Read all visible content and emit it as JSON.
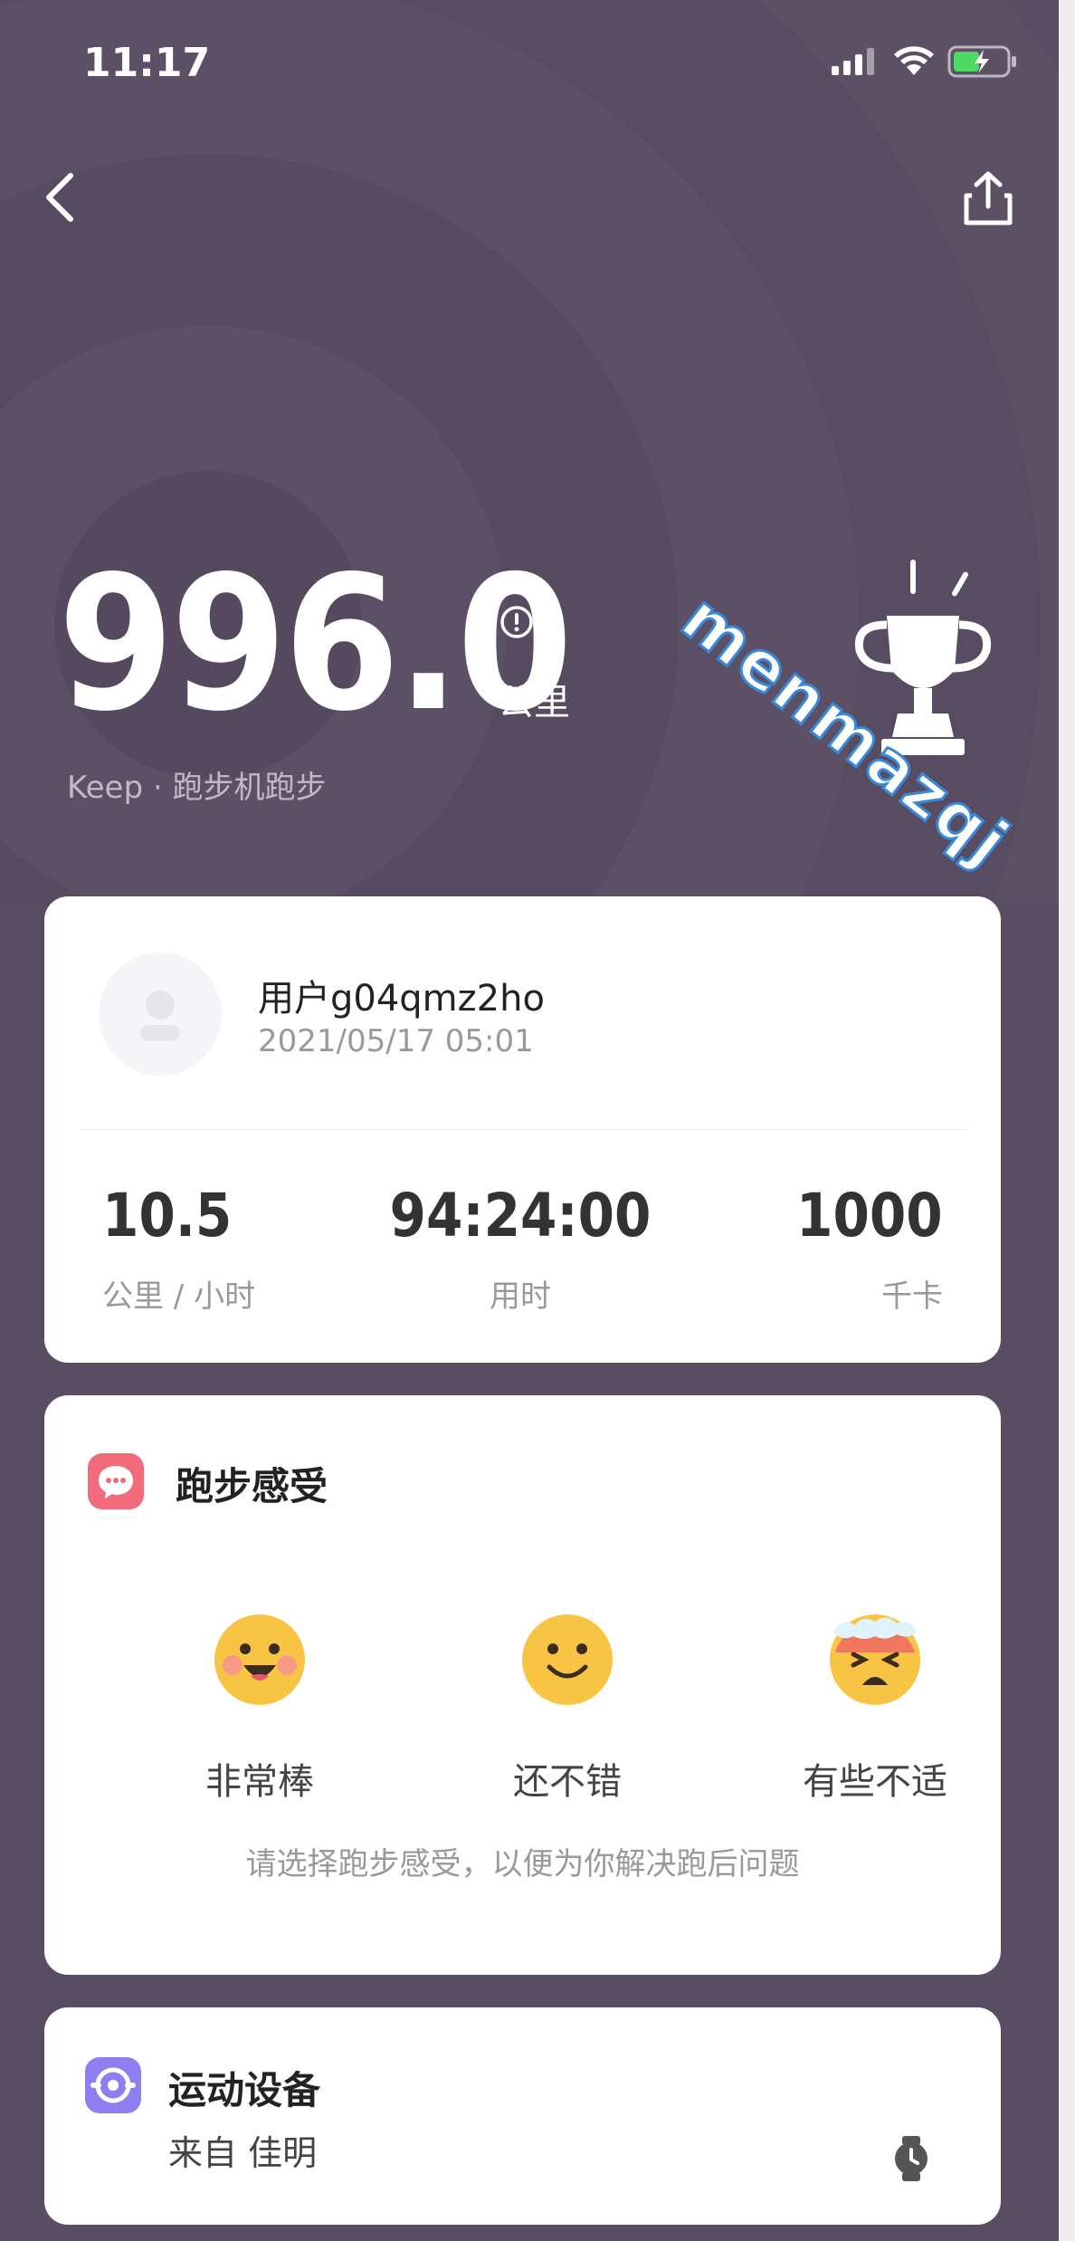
{
  "status_bar": {
    "time": "11:17"
  },
  "nav": {
    "back_icon": "chevron-left-icon",
    "share_icon": "share-icon"
  },
  "hero": {
    "distance": "996.0",
    "unit": "公里",
    "source": "Keep · 跑步机跑步",
    "watermark": "menmazqj"
  },
  "user_card": {
    "name": "用户g04qmz2ho",
    "datetime": "2021/05/17 05:01",
    "stats": [
      {
        "value": "10.5",
        "label": "公里 / 小时"
      },
      {
        "value": "94:24:00",
        "label": "用时"
      },
      {
        "value": "1000",
        "label": "千卡"
      }
    ]
  },
  "feel_card": {
    "title": "跑步感受",
    "options": [
      {
        "label": "非常棒",
        "icon": "grinning-face-icon"
      },
      {
        "label": "还不错",
        "icon": "smiling-face-icon"
      },
      {
        "label": "有些不适",
        "icon": "overheated-face-icon"
      }
    ],
    "hint": "请选择跑步感受，以便为你解决跑后问题"
  },
  "device_card": {
    "title": "运动设备",
    "source": "来自 佳明"
  },
  "colors": {
    "background": "#594d63",
    "card": "#ffffff",
    "feel_icon": "#f26b7a",
    "device_icon": "#8e7ff0",
    "emoji_yellow": "#f7c443"
  }
}
